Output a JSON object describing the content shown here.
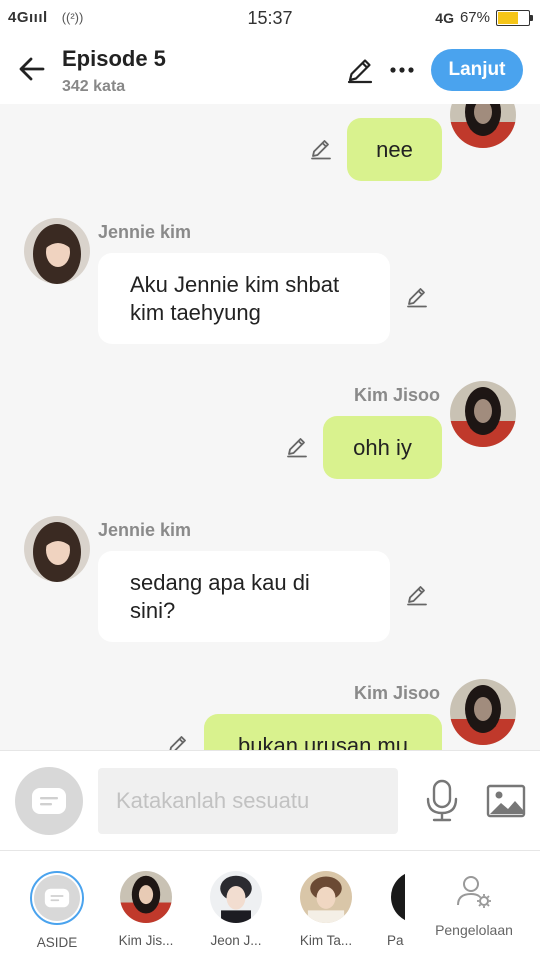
{
  "status_bar": {
    "signal": "4G",
    "hotspot": "((²))",
    "time": "15:37",
    "network": "4G",
    "battery_percent": "67%",
    "battery_level": 0.67
  },
  "header": {
    "title": "Episode 5",
    "word_count": "342 kata",
    "next_label": "Lanjut"
  },
  "messages": [
    {
      "side": "right",
      "sender": "",
      "text": "nee"
    },
    {
      "side": "left",
      "sender": "Jennie kim",
      "text": "Aku Jennie kim shbat kim taehyung"
    },
    {
      "side": "right",
      "sender": "Kim Jisoo",
      "text": "ohh iy"
    },
    {
      "side": "left",
      "sender": "Jennie kim",
      "text": "sedang apa kau di sini?"
    },
    {
      "side": "right",
      "sender": "Kim Jisoo",
      "text": "bukan urusan mu"
    }
  ],
  "composer": {
    "placeholder": "Katakanlah sesuatu"
  },
  "characters": [
    {
      "label": "ASIDE"
    },
    {
      "label": "Kim Jis..."
    },
    {
      "label": "Jeon J..."
    },
    {
      "label": "Kim Ta..."
    },
    {
      "label": "Pa"
    }
  ],
  "manage_label": "Pengelolaan",
  "colors": {
    "accent": "#4aa3ee",
    "bubble_right": "#d9f28e",
    "bubble_left": "#ffffff",
    "background": "#f6f6f6"
  }
}
